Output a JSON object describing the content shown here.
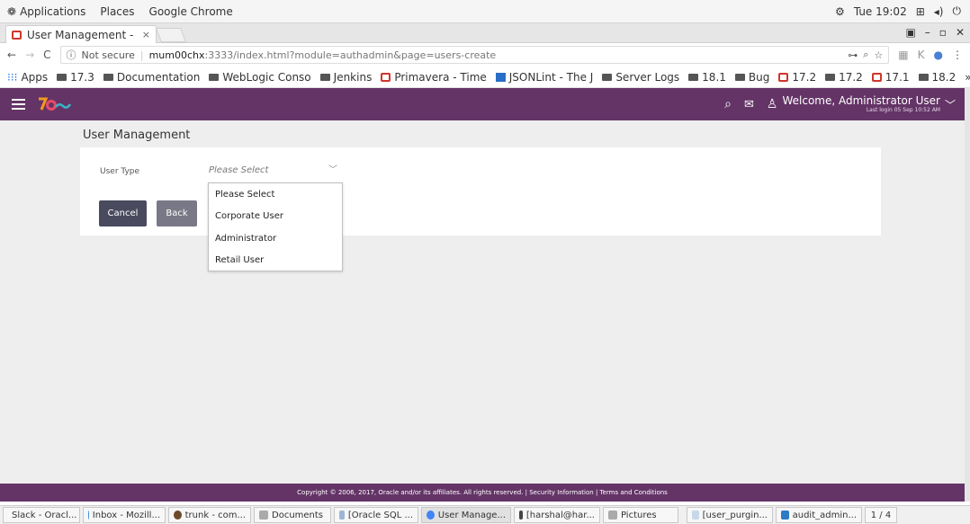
{
  "system": {
    "menu": [
      "Applications",
      "Places",
      "Google Chrome"
    ],
    "clock": "Tue 19:02"
  },
  "browser": {
    "tab_title": "User Management - ",
    "tab_close": "×",
    "security_label": "Not secure",
    "url_host": "mum00chx",
    "url_path": ":3333/index.html?module=authadmin&page=users-create",
    "bookmarks": [
      {
        "label": "Apps",
        "icon": "apps-grid-icon"
      },
      {
        "label": "17.3",
        "icon": "folder-icon"
      },
      {
        "label": "Documentation",
        "icon": "folder-icon"
      },
      {
        "label": "WebLogic Conso",
        "icon": "folder-icon"
      },
      {
        "label": "Jenkins",
        "icon": "folder-icon"
      },
      {
        "label": "Primavera - Time",
        "icon": "oracle-icon"
      },
      {
        "label": "JSONLint - The J",
        "icon": "jsonlint-icon"
      },
      {
        "label": "Server Logs",
        "icon": "folder-icon"
      },
      {
        "label": "18.1",
        "icon": "folder-icon"
      },
      {
        "label": "Bug",
        "icon": "folder-icon"
      },
      {
        "label": "17.2",
        "icon": "oracle-icon"
      },
      {
        "label": "17.2",
        "icon": "folder-icon"
      },
      {
        "label": "17.1",
        "icon": "oracle-icon"
      },
      {
        "label": "18.2",
        "icon": "folder-icon"
      }
    ],
    "more": "»"
  },
  "header": {
    "welcome": "Welcome, Administrator User",
    "last_login": "Last login 05 Sep 10:52 AM"
  },
  "page": {
    "title": "User Management",
    "field_label": "User Type",
    "select_value": "Please Select",
    "cancel_label": "Cancel",
    "back_label": "Back",
    "options": [
      "Please Select",
      "Corporate User",
      "Administrator",
      "Retail User"
    ]
  },
  "footer": {
    "text": "Copyright © 2006, 2017, Oracle and/or its affiliates. All rights reserved. | Security Information | Terms and Conditions"
  },
  "taskbar": {
    "items": [
      {
        "label": "Slack - Oracl...",
        "active": false
      },
      {
        "label": "Inbox - Mozill...",
        "active": false
      },
      {
        "label": "trunk - com...",
        "active": false
      },
      {
        "label": "Documents",
        "active": false
      },
      {
        "label": "[Oracle SQL ...",
        "active": false
      },
      {
        "label": "User Manage...",
        "active": true
      },
      {
        "label": "[harshal@har...",
        "active": false
      },
      {
        "label": "Pictures",
        "active": false
      },
      {
        "label": "[user_purgin...",
        "active": false
      },
      {
        "label": "audit_admin...",
        "active": false
      }
    ],
    "workspace": "1 / 4"
  },
  "colors": {
    "brand": "#643467",
    "button": "#4a4a5e",
    "content_bg": "#eeeeee"
  }
}
